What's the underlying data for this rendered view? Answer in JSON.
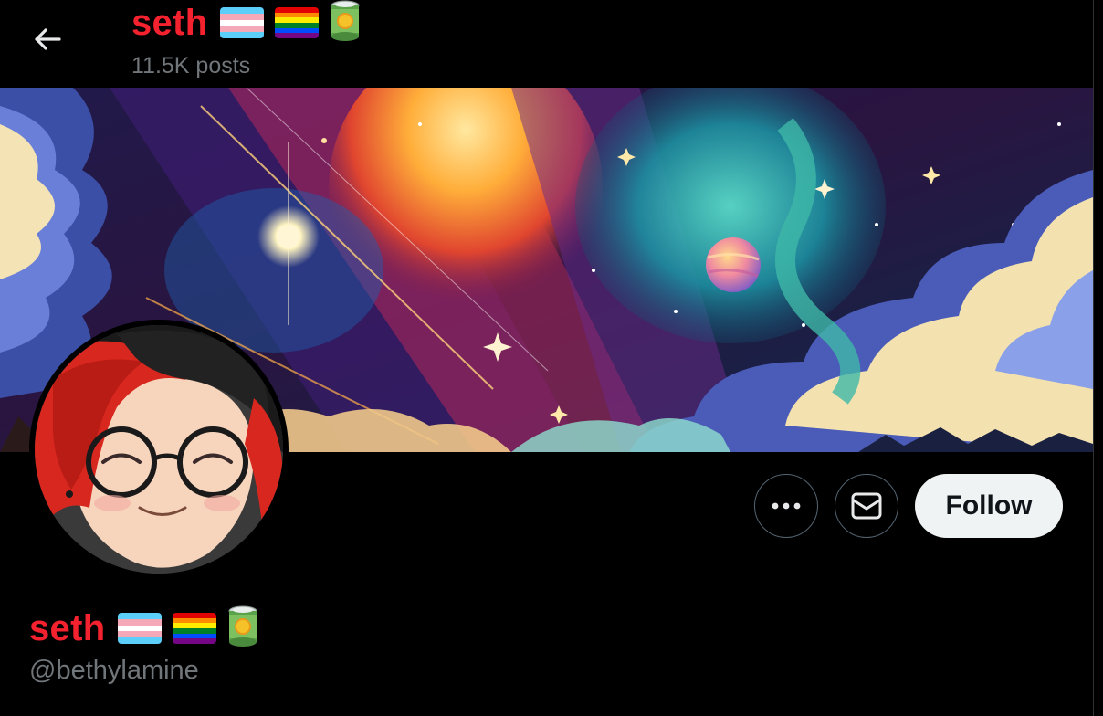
{
  "header": {
    "back_label": "Back",
    "display_name": "seth",
    "posts_count": "11.5K posts"
  },
  "profile": {
    "display_name": "seth",
    "handle": "@bethylamine",
    "name_emojis": [
      "transgender-flag-icon",
      "rainbow-flag-icon",
      "canned-food-icon"
    ]
  },
  "actions": {
    "more_icon": "more-dots-icon",
    "message_icon": "envelope-icon",
    "follow_label": "Follow"
  },
  "colors": {
    "name_red": "#f4212e",
    "muted_text": "#71767b",
    "follow_bg": "#eff3f4",
    "background": "#000000"
  }
}
